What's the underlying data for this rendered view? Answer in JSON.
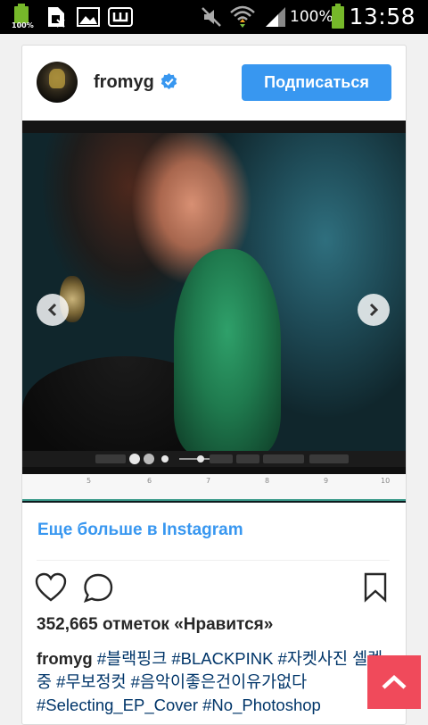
{
  "status_bar": {
    "notification_badge": "100%",
    "battery_percent": "100%",
    "time": "13:58",
    "icons": [
      "battery-charging-icon",
      "no-sim-icon",
      "gallery-icon",
      "keyboard-icon",
      "mute-icon",
      "wifi-icon",
      "signal-icon",
      "battery-icon"
    ]
  },
  "post": {
    "username": "fromyg",
    "verified": true,
    "follow_label": "Подписаться",
    "accent_color": "#3897f0",
    "photo": {
      "toolbar_ruler_numbers": [
        "5",
        "6",
        "7",
        "8",
        "9",
        "10"
      ]
    },
    "more_link": "Еще больше в Instagram",
    "likes_text": "352,665 отметок «Нравится»",
    "caption": {
      "user": "fromyg",
      "tags": "#블랙핑크 #BLACKPINK #자켓사진 셀렉중 #무보정컷 #음악이좋은건이유가없다 #Selecting_EP_Cover #No_Photoshop"
    }
  },
  "floating_button": {
    "icon": "chevron-up-icon",
    "color": "#f04a5b"
  }
}
